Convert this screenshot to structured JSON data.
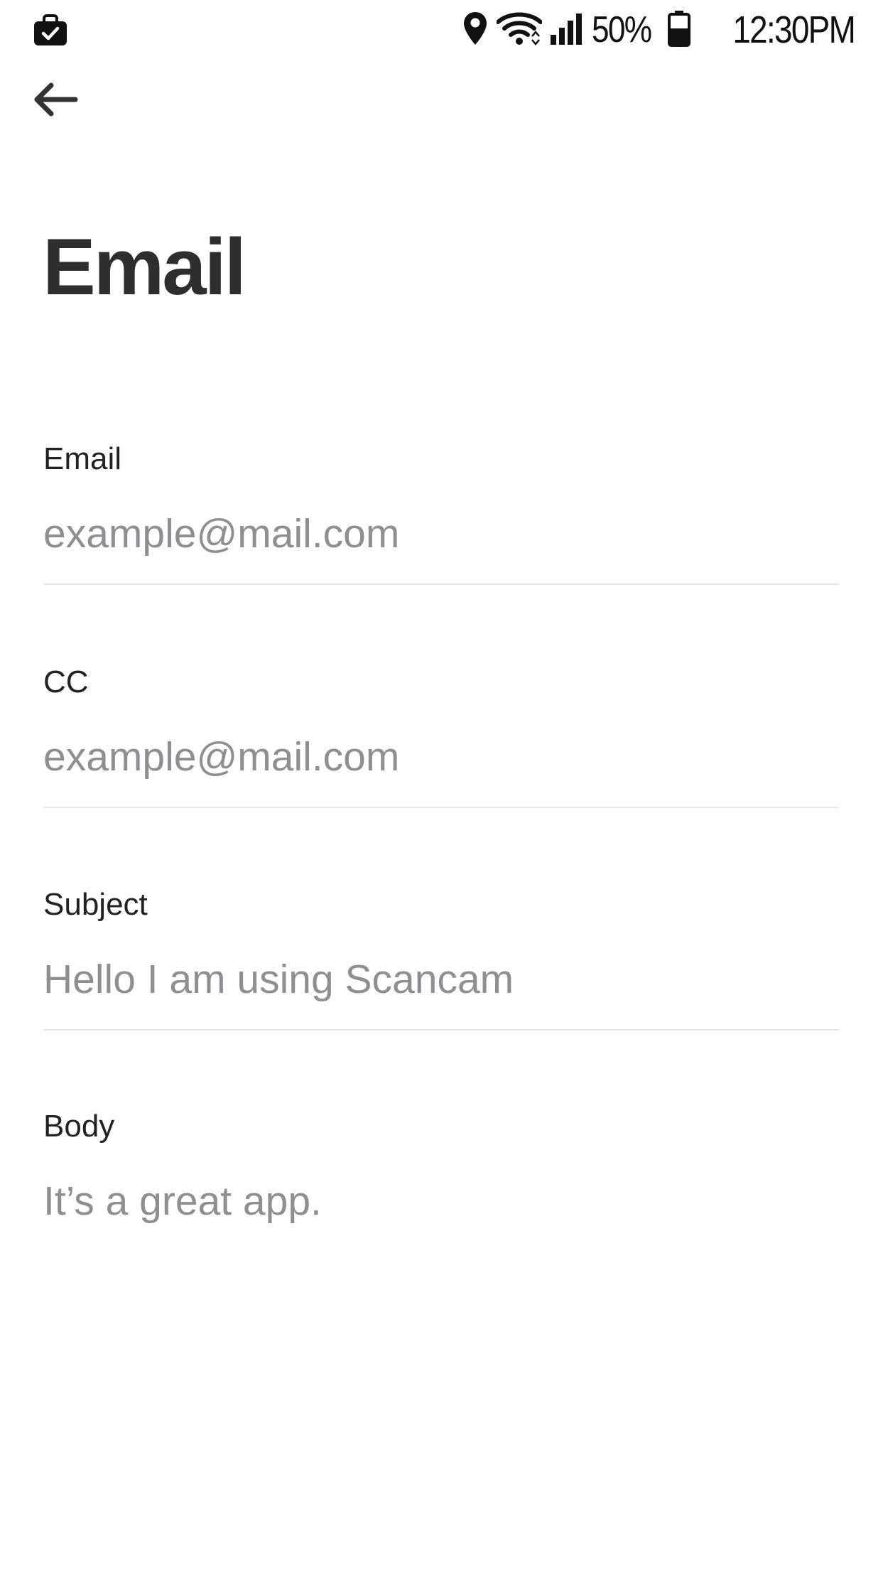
{
  "status_bar": {
    "battery_percent": "50%",
    "time": "12:30PM",
    "icons": [
      "shopping-bag-icon",
      "location-pin-icon",
      "wifi-icon",
      "signal-icon",
      "battery-icon"
    ]
  },
  "app_bar": {
    "back_icon": "arrow-left-icon"
  },
  "page": {
    "title": "Email"
  },
  "form": {
    "email": {
      "label": "Email",
      "placeholder": "example@mail.com"
    },
    "cc": {
      "label": "CC",
      "placeholder": "example@mail.com"
    },
    "subject": {
      "label": "Subject",
      "placeholder": "Hello I am using Scancam"
    },
    "body": {
      "label": "Body",
      "placeholder": "It’s a great app."
    }
  },
  "colors": {
    "title": "#2e2e2e",
    "label": "#222222",
    "placeholder": "#8e8e93",
    "divider": "#e5e5ea",
    "background": "#ffffff"
  }
}
